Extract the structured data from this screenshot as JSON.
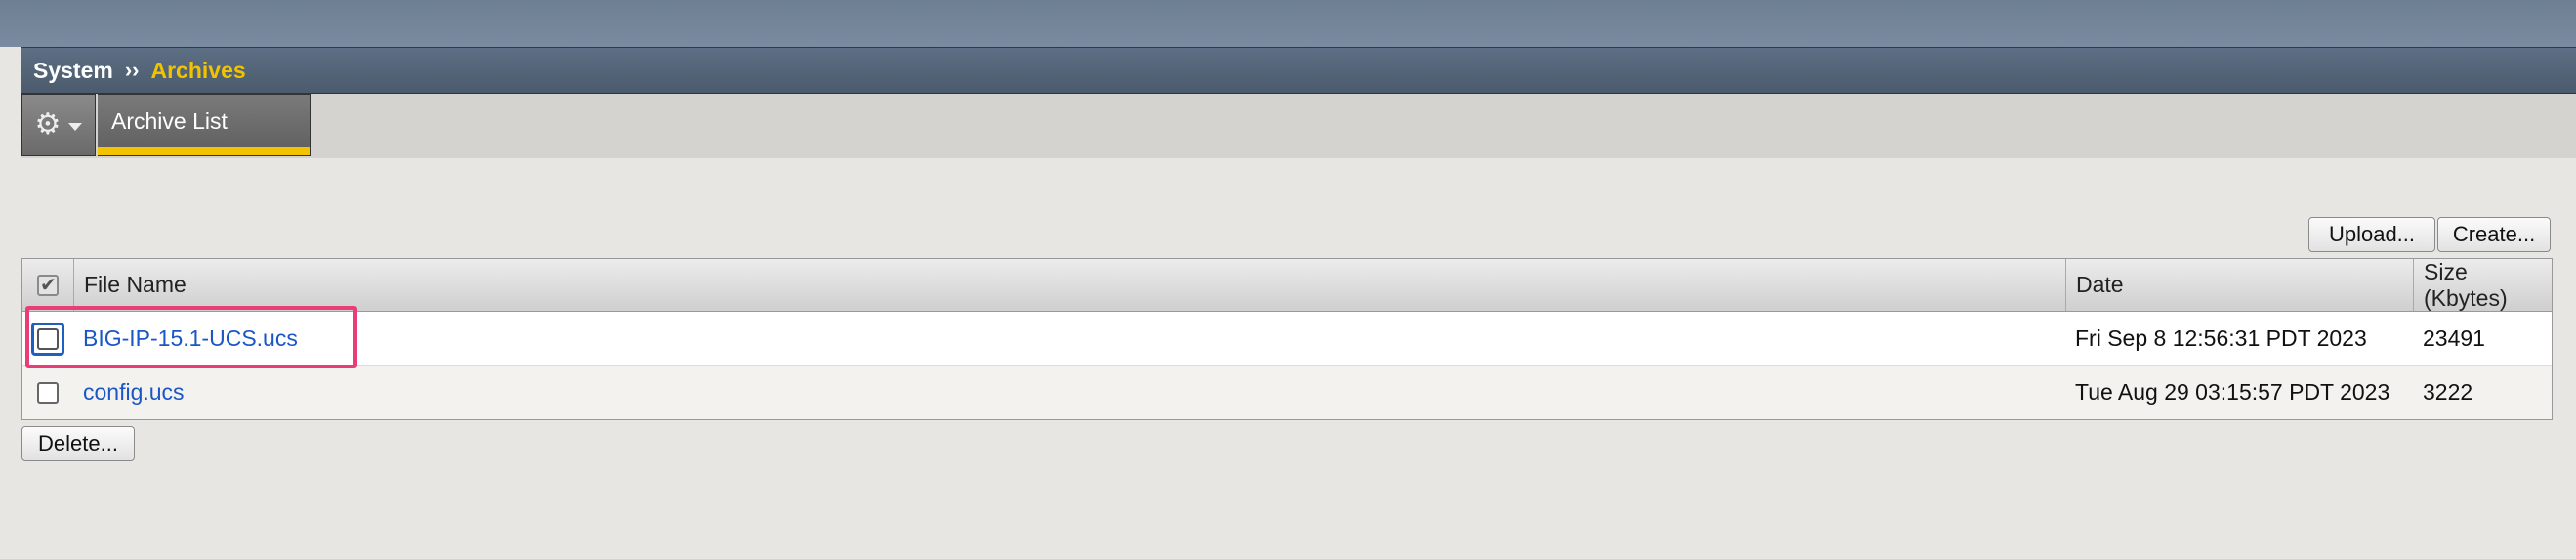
{
  "breadcrumb": {
    "system": "System",
    "separator": "››",
    "current": "Archives"
  },
  "tabs": {
    "menu_icon": "gear-icon",
    "active_tab": "Archive List"
  },
  "actions": {
    "upload": "Upload...",
    "create": "Create...",
    "delete": "Delete..."
  },
  "table": {
    "columns": {
      "file_name": "File Name",
      "date": "Date",
      "size": "Size (Kbytes)"
    },
    "rows": [
      {
        "file_name": "BIG-IP-15.1-UCS.ucs",
        "date": "Fri Sep 8 12:56:31 PDT 2023",
        "size": "23491"
      },
      {
        "file_name": "config.ucs",
        "date": "Tue Aug 29 03:15:57 PDT 2023",
        "size": "3222"
      }
    ]
  },
  "colors": {
    "accent": "#f3c300",
    "link": "#1a56c5",
    "highlight": "#ea3d77",
    "header_bar": "#4b5b6d"
  }
}
